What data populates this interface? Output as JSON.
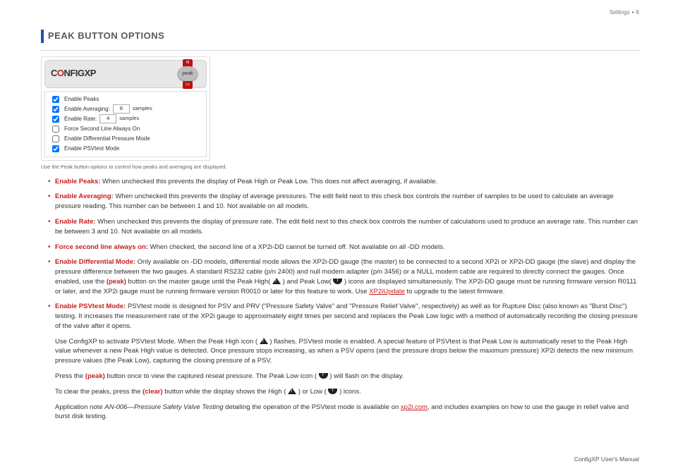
{
  "header": {
    "section": "Settings",
    "page": "6"
  },
  "footer": {
    "text": "ConfigXP User's Manual"
  },
  "title": "PEAK BUTTON OPTIONS",
  "panel": {
    "logo": {
      "c": "C",
      "o": "O",
      "nfig": "NFIG",
      "xp": "XP"
    },
    "peak": {
      "hi": "Hi",
      "lo": "Lo",
      "label": "peak"
    },
    "rows": {
      "enable_peaks": {
        "label": "Enable Peaks",
        "checked": true
      },
      "enable_avg": {
        "label": "Enable Averaging:",
        "checked": true,
        "val": "8",
        "unit": "samples"
      },
      "enable_rate": {
        "label": "Enable Rate:",
        "checked": true,
        "val": "4",
        "unit": "samples"
      },
      "force_second": {
        "label": "Force Second Line Always On",
        "checked": false
      },
      "enable_diff": {
        "label": "Enable Differential Pressure Mode",
        "checked": false
      },
      "enable_psv": {
        "label": "Enable PSVtest Mode",
        "checked": true
      }
    }
  },
  "caption": "Use the Peak button options to control how peaks and averaging are displayed.",
  "items": {
    "peaks": {
      "term": "Enable Peaks:",
      "text": " When unchecked this prevents the display of Peak High or Peak Low. This does not affect averaging, if available."
    },
    "avg": {
      "term": "Enable Averaging:",
      "text": " When unchecked this prevents the display of average pressures. The edit field next to this check box controls the number of samples to be used to calculate an average pressure reading. This number can be between 1 and 10. Not available on all models."
    },
    "rate": {
      "term": "Enable Rate:",
      "text": " When unchecked this prevents the display of pressure rate. The edit field next to this check box controls the number of calculations used to produce an average rate. This number can be between 3 and 10. Not available on all models."
    },
    "force": {
      "term": "Force second line always on:",
      "text": " When checked, the second line of a XP2i-DD cannot be turned off. Not available on all -DD models."
    },
    "diff": {
      "term": "Enable Differential Mode:",
      "pre": " Only available on -DD models, differential mode allows the XP2i-DD gauge (the master) to be connected to a second XP2i or XP2i-DD gauge (the slave) and display the pressure difference between the two gauges. A standard RS232 cable (p/n 2400) and null modem adapter (p/n 3456) or a NULL modem cable are required to directly connect the gauges. Once enabled, use the ",
      "btn": "peak",
      "mid1": " button on the master gauge until the Peak High( ",
      "mid2": " ) and Peak Low( ",
      "mid3": " ) icons are displayed simultaneously. The XP2i-DD gauge must be running firmware version R0111 or later, and the XP2i gauge must be running firmware version R0010 or later for this feature to work. Use ",
      "link": "XP2iUpdate",
      "post": " to upgrade to the latest firmware."
    },
    "psv": {
      "term": "Enable PSVtest Mode:",
      "p1": " PSVtest mode is designed for PSV and PRV (\"Pressure Safety Valve\" and \"Pressure Relief Valve\", respectively) as well as for Rupture Disc (also known as \"Burst Disc\") testing. It increases the measurement rate of the XP2i gauge to approximately eight times per second and replaces the Peak Low logic with a method of automatically recording the closing pressure of the valve after it opens.",
      "p2a": "Use ConfigXP to activate PSVtest Mode. When the Peak High icon ( ",
      "p2b": " ) flashes, PSVtest mode is enabled. A special feature of PSVtest is that Peak Low is automatically reset to the Peak High value whenever a new Peak High value is detected. Once pressure stops increasing, as when a PSV opens (and the pressure drops below the maximum pressure) XP2i detects the new minimum pressure values (the Peak Low), capturing the closing pressure of a PSV.",
      "p3a": "Press the ",
      "p3btn": "peak",
      "p3b": " button once to view the captured reseat pressure. The Peak Low icon ( ",
      "p3c": " ) will flash on the display.",
      "p4a": "To clear the peaks, press the ",
      "p4btn": "clear",
      "p4b": " button while the display shows the High ( ",
      "p4c": " ) or Low ( ",
      "p4d": " ) icons.",
      "p5a": "Application note ",
      "p5i": "AN-006—Pressure Safety Valve Testing",
      "p5b": " detailing the operation of the PSVtest mode is available on ",
      "p5link": "xp2i.com",
      "p5c": ", and includes examples on how to use the gauge in relief valve and burst disk testing."
    }
  }
}
